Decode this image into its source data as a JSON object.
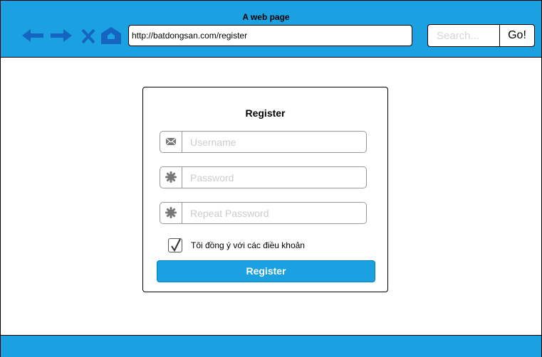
{
  "browser": {
    "title": "A web page",
    "url": "http://batdongsan.com/register",
    "search_placeholder": "Search...",
    "search_value": "",
    "go_label": "Go!"
  },
  "nav_icons": [
    "back-arrow-icon",
    "forward-arrow-icon",
    "close-icon",
    "home-icon"
  ],
  "form": {
    "title": "Register",
    "username_placeholder": "Username",
    "password_placeholder": "Password",
    "repeat_password_placeholder": "Repeat Password",
    "terms_label": "Tôi đồng ý với các điều khoản",
    "terms_checked": true,
    "submit_label": "Register"
  },
  "colors": {
    "accent": "#1ba1e2",
    "nav_icon": "#1565c0"
  }
}
